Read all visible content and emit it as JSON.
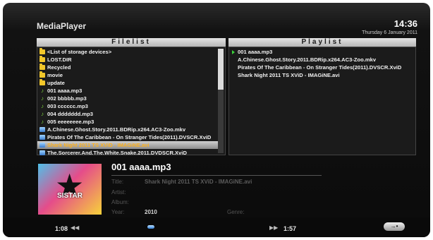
{
  "header": {
    "app_title": "MediaPlayer",
    "time": "14:36",
    "date": "Thursday 6 January 2011"
  },
  "filelist": {
    "title": "Filelist",
    "items": [
      {
        "icon": "folder-icon",
        "label": "<List of storage devices>"
      },
      {
        "icon": "folder-icon",
        "label": "LOST.DIR"
      },
      {
        "icon": "folder-icon",
        "label": "Recycled"
      },
      {
        "icon": "folder-icon",
        "label": "movie"
      },
      {
        "icon": "folder-icon",
        "label": "update"
      },
      {
        "icon": "music-note-icon",
        "label": "001 aaaa.mp3"
      },
      {
        "icon": "music-note-icon",
        "label": "002 bbbbb.mp3"
      },
      {
        "icon": "music-note-icon",
        "label": "003 cccccc.mp3"
      },
      {
        "icon": "music-note-icon",
        "label": "004 ddddddd.mp3"
      },
      {
        "icon": "music-note-icon",
        "label": "005 eeeeeeee.mp3"
      },
      {
        "icon": "video-file-icon",
        "label": "A.Chinese.Ghost.Story.2011.BDRip.x264.AC3-Zoo.mkv"
      },
      {
        "icon": "video-file-icon",
        "label": "Pirates Of The Caribbean - On Stranger Tides(2011).DVSCR.XviD"
      },
      {
        "icon": "video-file-icon",
        "label": "Shark Night 2011 TS XViD - IMAGiNE.avi",
        "selected": true
      },
      {
        "icon": "video-file-icon",
        "label": "The.Sorcerer.And.The.White.Snake.2011.DVDSCR.XviD"
      }
    ],
    "scroll_position": 0.35
  },
  "playlist": {
    "title": "Playlist",
    "items": [
      {
        "playing": true,
        "label": "001 aaaa.mp3"
      },
      {
        "playing": false,
        "label": "A.Chinese.Ghost.Story.2011.BDRip.x264.AC3-Zoo.mkv"
      },
      {
        "playing": false,
        "label": "Pirates Of The Caribbean - On Stranger Tides(2011).DVSCR.XviD"
      },
      {
        "playing": false,
        "label": "Shark Night 2011 TS XViD - IMAGiNE.avi"
      }
    ]
  },
  "now_playing": {
    "title": "001 aaaa.mp3",
    "album_art_text": "SISTAR",
    "title_label": "Title:",
    "title_value": "Shark Night 2011 TS XViD - IMAGiNE.avi",
    "artist_label": "Artist:",
    "artist_value": "",
    "album_label": "Album:",
    "album_value": "",
    "year_label": "Year:",
    "year_value": "2010",
    "genre_label": "Genre:",
    "genre_value": ""
  },
  "transport": {
    "elapsed": "1:08",
    "total": "1:57",
    "rewind_icon": "rewind-icon",
    "fast_forward_icon": "fast-forward-icon",
    "repeat_icon": "repeat-icon"
  },
  "colors": {
    "selected_text": "#ffb21c",
    "folder": "#f2c72a",
    "note": "#7bd23c",
    "play_arrow": "#3ad13a"
  }
}
